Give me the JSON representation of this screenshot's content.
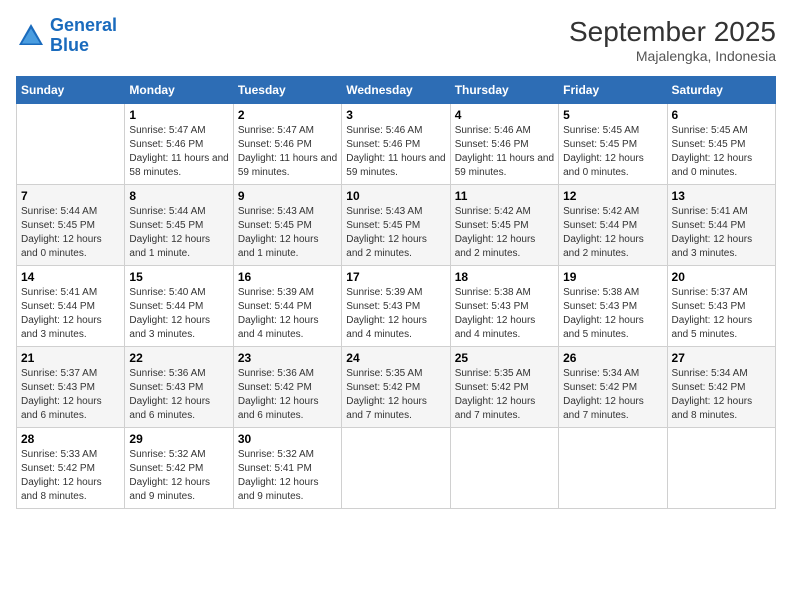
{
  "logo": {
    "line1": "General",
    "line2": "Blue"
  },
  "title": "September 2025",
  "subtitle": "Majalengka, Indonesia",
  "headers": [
    "Sunday",
    "Monday",
    "Tuesday",
    "Wednesday",
    "Thursday",
    "Friday",
    "Saturday"
  ],
  "weeks": [
    [
      {
        "day": "",
        "empty": true
      },
      {
        "day": "1",
        "sunrise": "Sunrise: 5:47 AM",
        "sunset": "Sunset: 5:46 PM",
        "daylight": "Daylight: 11 hours and 58 minutes."
      },
      {
        "day": "2",
        "sunrise": "Sunrise: 5:47 AM",
        "sunset": "Sunset: 5:46 PM",
        "daylight": "Daylight: 11 hours and 59 minutes."
      },
      {
        "day": "3",
        "sunrise": "Sunrise: 5:46 AM",
        "sunset": "Sunset: 5:46 PM",
        "daylight": "Daylight: 11 hours and 59 minutes."
      },
      {
        "day": "4",
        "sunrise": "Sunrise: 5:46 AM",
        "sunset": "Sunset: 5:46 PM",
        "daylight": "Daylight: 11 hours and 59 minutes."
      },
      {
        "day": "5",
        "sunrise": "Sunrise: 5:45 AM",
        "sunset": "Sunset: 5:45 PM",
        "daylight": "Daylight: 12 hours and 0 minutes."
      },
      {
        "day": "6",
        "sunrise": "Sunrise: 5:45 AM",
        "sunset": "Sunset: 5:45 PM",
        "daylight": "Daylight: 12 hours and 0 minutes."
      }
    ],
    [
      {
        "day": "7",
        "sunrise": "Sunrise: 5:44 AM",
        "sunset": "Sunset: 5:45 PM",
        "daylight": "Daylight: 12 hours and 0 minutes."
      },
      {
        "day": "8",
        "sunrise": "Sunrise: 5:44 AM",
        "sunset": "Sunset: 5:45 PM",
        "daylight": "Daylight: 12 hours and 1 minute."
      },
      {
        "day": "9",
        "sunrise": "Sunrise: 5:43 AM",
        "sunset": "Sunset: 5:45 PM",
        "daylight": "Daylight: 12 hours and 1 minute."
      },
      {
        "day": "10",
        "sunrise": "Sunrise: 5:43 AM",
        "sunset": "Sunset: 5:45 PM",
        "daylight": "Daylight: 12 hours and 2 minutes."
      },
      {
        "day": "11",
        "sunrise": "Sunrise: 5:42 AM",
        "sunset": "Sunset: 5:45 PM",
        "daylight": "Daylight: 12 hours and 2 minutes."
      },
      {
        "day": "12",
        "sunrise": "Sunrise: 5:42 AM",
        "sunset": "Sunset: 5:44 PM",
        "daylight": "Daylight: 12 hours and 2 minutes."
      },
      {
        "day": "13",
        "sunrise": "Sunrise: 5:41 AM",
        "sunset": "Sunset: 5:44 PM",
        "daylight": "Daylight: 12 hours and 3 minutes."
      }
    ],
    [
      {
        "day": "14",
        "sunrise": "Sunrise: 5:41 AM",
        "sunset": "Sunset: 5:44 PM",
        "daylight": "Daylight: 12 hours and 3 minutes."
      },
      {
        "day": "15",
        "sunrise": "Sunrise: 5:40 AM",
        "sunset": "Sunset: 5:44 PM",
        "daylight": "Daylight: 12 hours and 3 minutes."
      },
      {
        "day": "16",
        "sunrise": "Sunrise: 5:39 AM",
        "sunset": "Sunset: 5:44 PM",
        "daylight": "Daylight: 12 hours and 4 minutes."
      },
      {
        "day": "17",
        "sunrise": "Sunrise: 5:39 AM",
        "sunset": "Sunset: 5:43 PM",
        "daylight": "Daylight: 12 hours and 4 minutes."
      },
      {
        "day": "18",
        "sunrise": "Sunrise: 5:38 AM",
        "sunset": "Sunset: 5:43 PM",
        "daylight": "Daylight: 12 hours and 4 minutes."
      },
      {
        "day": "19",
        "sunrise": "Sunrise: 5:38 AM",
        "sunset": "Sunset: 5:43 PM",
        "daylight": "Daylight: 12 hours and 5 minutes."
      },
      {
        "day": "20",
        "sunrise": "Sunrise: 5:37 AM",
        "sunset": "Sunset: 5:43 PM",
        "daylight": "Daylight: 12 hours and 5 minutes."
      }
    ],
    [
      {
        "day": "21",
        "sunrise": "Sunrise: 5:37 AM",
        "sunset": "Sunset: 5:43 PM",
        "daylight": "Daylight: 12 hours and 6 minutes."
      },
      {
        "day": "22",
        "sunrise": "Sunrise: 5:36 AM",
        "sunset": "Sunset: 5:43 PM",
        "daylight": "Daylight: 12 hours and 6 minutes."
      },
      {
        "day": "23",
        "sunrise": "Sunrise: 5:36 AM",
        "sunset": "Sunset: 5:42 PM",
        "daylight": "Daylight: 12 hours and 6 minutes."
      },
      {
        "day": "24",
        "sunrise": "Sunrise: 5:35 AM",
        "sunset": "Sunset: 5:42 PM",
        "daylight": "Daylight: 12 hours and 7 minutes."
      },
      {
        "day": "25",
        "sunrise": "Sunrise: 5:35 AM",
        "sunset": "Sunset: 5:42 PM",
        "daylight": "Daylight: 12 hours and 7 minutes."
      },
      {
        "day": "26",
        "sunrise": "Sunrise: 5:34 AM",
        "sunset": "Sunset: 5:42 PM",
        "daylight": "Daylight: 12 hours and 7 minutes."
      },
      {
        "day": "27",
        "sunrise": "Sunrise: 5:34 AM",
        "sunset": "Sunset: 5:42 PM",
        "daylight": "Daylight: 12 hours and 8 minutes."
      }
    ],
    [
      {
        "day": "28",
        "sunrise": "Sunrise: 5:33 AM",
        "sunset": "Sunset: 5:42 PM",
        "daylight": "Daylight: 12 hours and 8 minutes."
      },
      {
        "day": "29",
        "sunrise": "Sunrise: 5:32 AM",
        "sunset": "Sunset: 5:42 PM",
        "daylight": "Daylight: 12 hours and 9 minutes."
      },
      {
        "day": "30",
        "sunrise": "Sunrise: 5:32 AM",
        "sunset": "Sunset: 5:41 PM",
        "daylight": "Daylight: 12 hours and 9 minutes."
      },
      {
        "day": "",
        "empty": true
      },
      {
        "day": "",
        "empty": true
      },
      {
        "day": "",
        "empty": true
      },
      {
        "day": "",
        "empty": true
      }
    ]
  ]
}
